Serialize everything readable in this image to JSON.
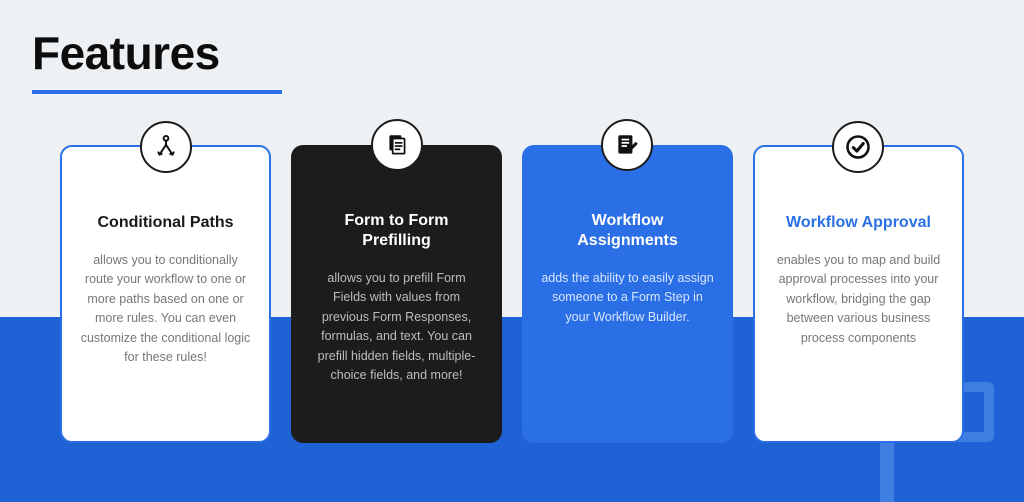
{
  "header": {
    "title": "Features"
  },
  "cards": [
    {
      "icon": "branch-icon",
      "title": "Conditional Paths",
      "body": "allows you to conditionally route your workflow to one or more paths based on one or more rules. You can even customize the conditional logic for these rules!"
    },
    {
      "icon": "copy-doc-icon",
      "title": "Form to Form Prefilling",
      "body": "allows you to prefill Form Fields with values from previous Form Responses, formulas, and text. You can prefill hidden fields, multiple-choice fields, and more!"
    },
    {
      "icon": "edit-doc-icon",
      "title": "Workflow Assignments",
      "body": "adds the ability to easily assign someone to a Form Step in your Workflow Builder."
    },
    {
      "icon": "check-circle-icon",
      "title": "Workflow Approval",
      "body": "enables you to map and build approval processes into your workflow, bridging the gap between various business process components"
    }
  ]
}
